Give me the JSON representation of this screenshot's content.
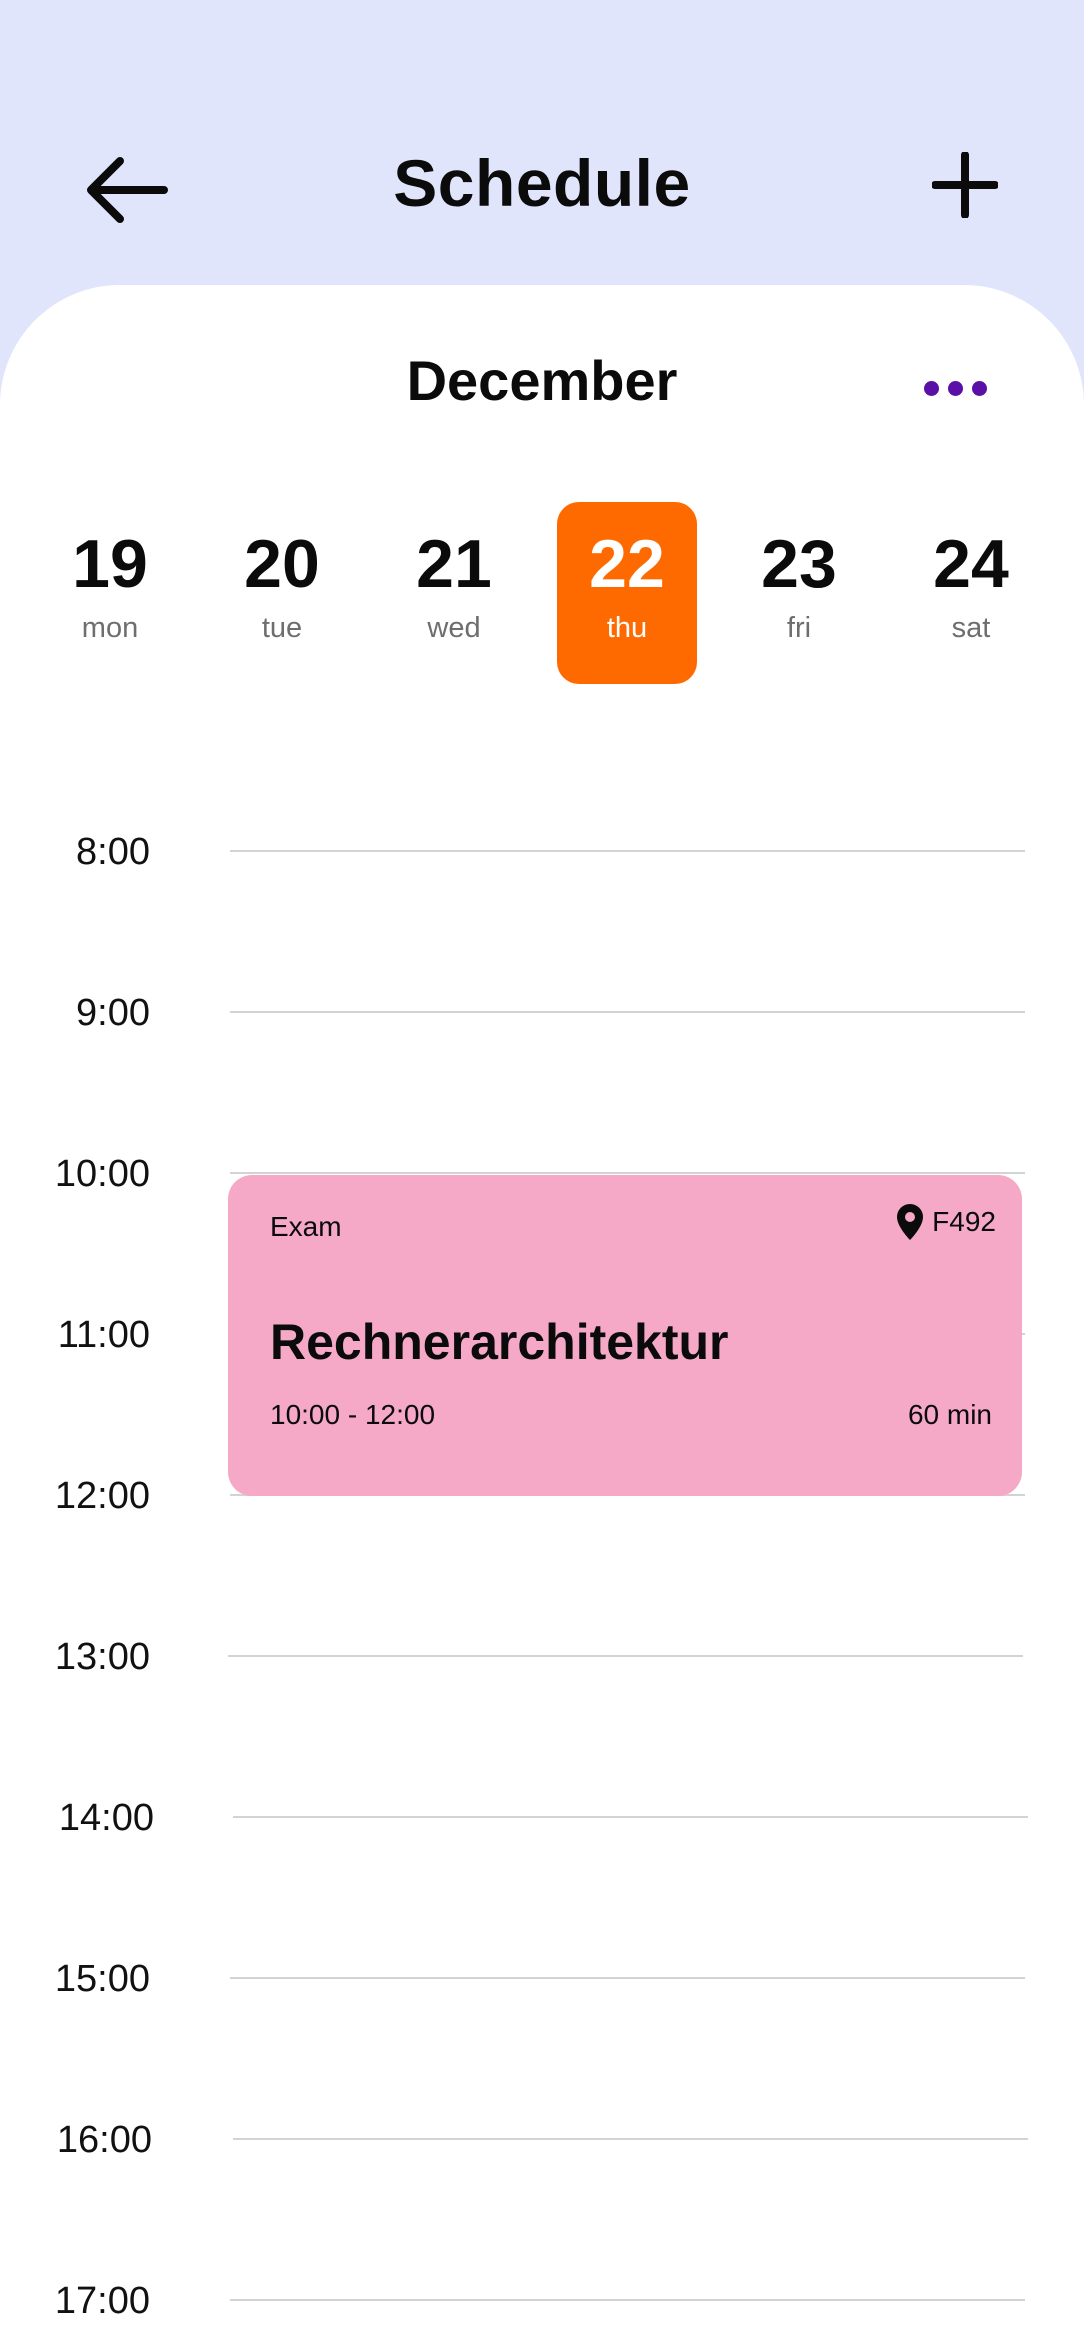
{
  "header": {
    "title": "Schedule",
    "back_icon": "arrow-left-icon",
    "add_icon": "plus-icon"
  },
  "calendar": {
    "month": "December",
    "more_icon": "more-dots-icon",
    "accent_color": "#5A0FA6",
    "selected_color": "#FF6A00",
    "days": [
      {
        "num": "19",
        "weekday": "mon",
        "selected": false
      },
      {
        "num": "20",
        "weekday": "tue",
        "selected": false
      },
      {
        "num": "21",
        "weekday": "wed",
        "selected": false
      },
      {
        "num": "22",
        "weekday": "thu",
        "selected": true
      },
      {
        "num": "23",
        "weekday": "fri",
        "selected": false
      },
      {
        "num": "24",
        "weekday": "sat",
        "selected": false
      }
    ]
  },
  "timeline": {
    "hours": [
      "8:00",
      "9:00",
      "10:00",
      "11:00",
      "12:00",
      "13:00",
      "14:00",
      "15:00",
      "16:00",
      "17:00"
    ]
  },
  "event": {
    "type": "Exam",
    "location": "F492",
    "location_icon": "map-pin-icon",
    "title": "Rechnerarchitektur",
    "time": "10:00 - 12:00",
    "duration": "60 min",
    "color": "#F5A9C6"
  }
}
